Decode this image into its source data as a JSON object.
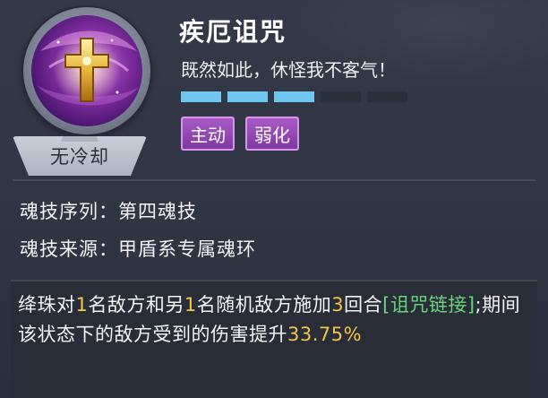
{
  "skill": {
    "name": "疾厄诅咒",
    "quote": "既然如此，休怪我不客气！",
    "cooldown": "无冷却",
    "icon": "holy-cross-icon",
    "energy": {
      "filled": 3,
      "total": 5
    },
    "tags": [
      "主动",
      "弱化"
    ]
  },
  "info": {
    "sequence_label": "魂技序列：",
    "sequence_value": "第四魂技",
    "source_label": "魂技来源：",
    "source_value": "甲盾系专属魂环"
  },
  "description": {
    "p1": "绛珠对",
    "n1": "1",
    "p2": "名敌方和另",
    "n2": "1",
    "p3": "名随机敌方施加",
    "n3": "3",
    "p4": "回合",
    "link": "[诅咒链接]",
    "p5": ";期间该状态下的敌方受到的伤害提升",
    "percent": "33.75%"
  },
  "colors": {
    "background": "#2f3442",
    "energy_filled": "#6fc6ee",
    "energy_empty": "#2a2f3a",
    "tag_purple": "#8f47b2",
    "number_gold": "#f5c447",
    "link_green": "#69d57b"
  }
}
